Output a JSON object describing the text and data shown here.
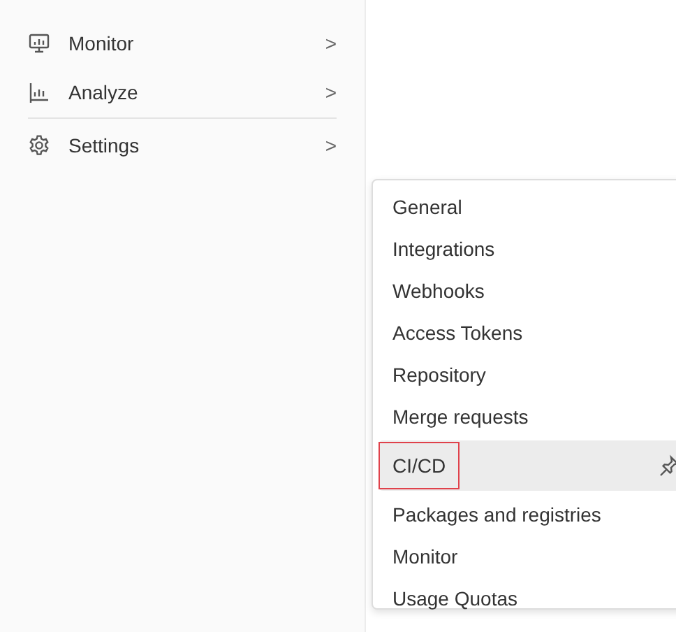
{
  "sidebar": {
    "items": [
      {
        "label": "Monitor",
        "kind": "monitor",
        "chevron": ">"
      },
      {
        "label": "Analyze",
        "kind": "analyze",
        "chevron": ">"
      },
      {
        "label": "Settings",
        "kind": "settings",
        "chevron": ">"
      }
    ]
  },
  "flyout": {
    "items": [
      {
        "label": "General",
        "selected": false,
        "outlined": false
      },
      {
        "label": "Integrations",
        "selected": false,
        "outlined": false
      },
      {
        "label": "Webhooks",
        "selected": false,
        "outlined": false
      },
      {
        "label": "Access Tokens",
        "selected": false,
        "outlined": false
      },
      {
        "label": "Repository",
        "selected": false,
        "outlined": false
      },
      {
        "label": "Merge requests",
        "selected": false,
        "outlined": false
      },
      {
        "label": "CI/CD",
        "selected": true,
        "outlined": true
      },
      {
        "label": "Packages and registries",
        "selected": false,
        "outlined": false
      },
      {
        "label": "Monitor",
        "selected": false,
        "outlined": false
      },
      {
        "label": "Usage Quotas",
        "selected": false,
        "outlined": false
      }
    ]
  }
}
